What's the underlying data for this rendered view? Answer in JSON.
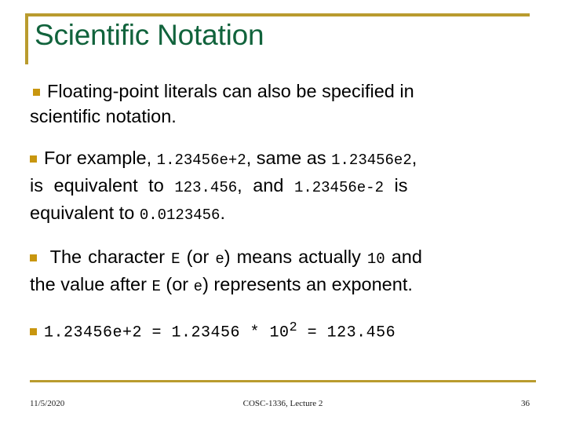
{
  "slide": {
    "title": "Scientific Notation",
    "theme": {
      "title_color": "#11633c",
      "accent_gold": "#b99b2e",
      "bullet_gold": "#c8960f",
      "body_color": "#000000",
      "background": "#ffffff"
    },
    "bullets": [
      {
        "id": "bullet-floating-point-literals",
        "line1": "Floating-point literals can also be specified in",
        "line2": "scientific notation."
      },
      {
        "id": "bullet-for-example",
        "run1": "For example,",
        "code1": "1.23456e+2",
        "run2": ", same as",
        "code2": "1.23456e2",
        "run3": ",",
        "run4": "is equivalent to",
        "code3": "123.456",
        "run5": ", and",
        "code4": "1.23456e-2",
        "run6": "is",
        "run7": "equivalent to",
        "code5": "0.0123456",
        "run8": "."
      },
      {
        "id": "bullet-character-e",
        "run1": "The character",
        "code1": "E",
        "run2": "(or",
        "code2": "e",
        "run3": ") means actually",
        "code3": "10",
        "run4": "and",
        "run5": "the value after",
        "code4": "E",
        "run6": "(or",
        "code5": "e",
        "run7": ") represents an exponent."
      },
      {
        "id": "bullet-formula",
        "code_left": "1.23456e+2 = 1.23456 * 10",
        "exponent": "2",
        "code_right": " = 123.456"
      }
    ]
  },
  "footer": {
    "date": "11/5/2020",
    "center": "COSC-1336, Lecture 2",
    "page": "36"
  }
}
